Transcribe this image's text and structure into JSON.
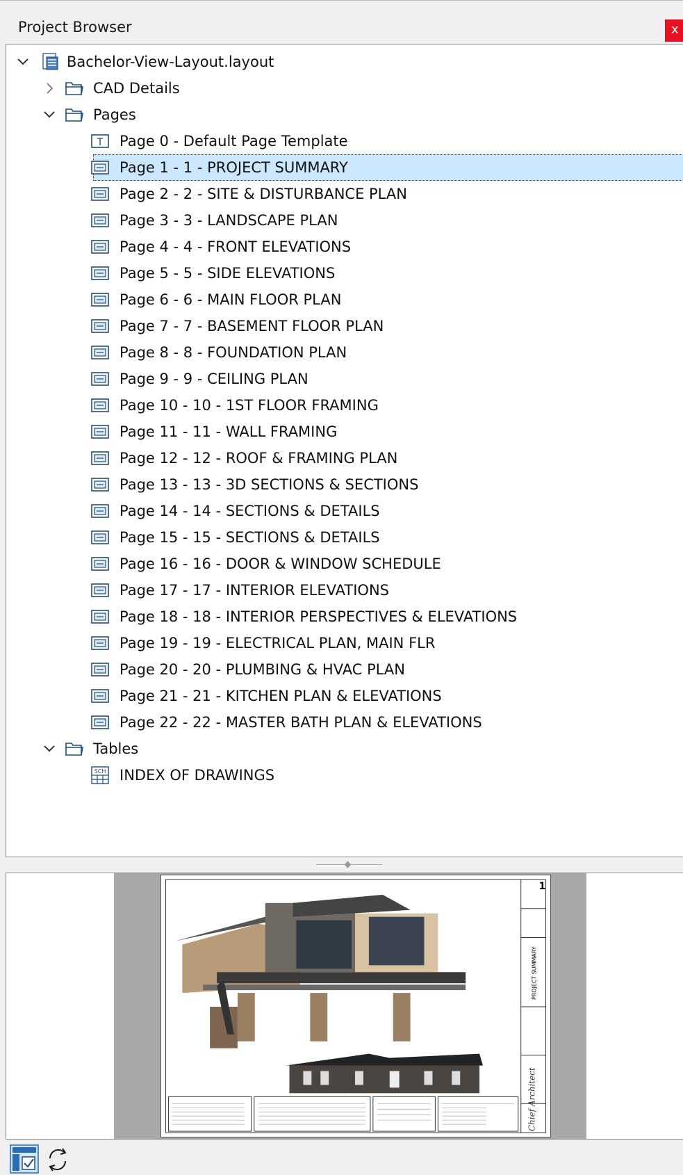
{
  "header": {
    "title": "Project Browser",
    "close_label": "x"
  },
  "tree": {
    "root": "Bachelor-View-Layout.layout",
    "folders": {
      "cad_details": "CAD Details",
      "pages": "Pages",
      "tables": "Tables"
    },
    "pages": [
      "Page 0 - Default Page Template",
      "Page 1 - 1 - PROJECT SUMMARY",
      "Page 2 - 2 - SITE & DISTURBANCE PLAN",
      "Page 3 - 3 - LANDSCAPE PLAN",
      "Page 4 - 4 - FRONT ELEVATIONS",
      "Page 5 - 5 - SIDE  ELEVATIONS",
      "Page 6 - 6 - MAIN FLOOR PLAN",
      "Page 7 - 7 - BASEMENT FLOOR PLAN",
      "Page 8 - 8 - FOUNDATION PLAN",
      "Page 9 - 9 - CEILING PLAN",
      "Page 10 - 10 - 1ST FLOOR FRAMING",
      "Page 11 - 11 - WALL FRAMING",
      "Page 12 - 12 - ROOF & FRAMING PLAN",
      "Page 13 - 13 - 3D SECTIONS & SECTIONS",
      "Page 14 - 14 - SECTIONS & DETAILS",
      "Page 15 - 15 - SECTIONS & DETAILS",
      "Page 16 - 16 - DOOR & WINDOW SCHEDULE",
      "Page 17 - 17 - INTERIOR ELEVATIONS",
      "Page 18 - 18 - INTERIOR PERSPECTIVES & ELEVATIONS",
      "Page 19 - 19 - ELECTRICAL PLAN, MAIN FLR",
      "Page 20 - 20 - PLUMBING & HVAC PLAN",
      "Page 21 - 21 - KITCHEN PLAN & ELEVATIONS",
      "Page 22 - 22 - MASTER BATH PLAN & ELEVATIONS"
    ],
    "selected_page_index": 1,
    "table_item": "INDEX OF DRAWINGS",
    "template_icon_letter": "T",
    "schedule_icon_text": "SCH"
  },
  "preview": {
    "sheet_number": "1",
    "sheet_title": "PROJECT SUMMARY",
    "logo_text": "Chief Architect"
  },
  "colors": {
    "selection": "#cce8ff",
    "close": "#e81123",
    "folder_stroke": "#1f4e79",
    "icon_blue": "#2b6cb0"
  }
}
